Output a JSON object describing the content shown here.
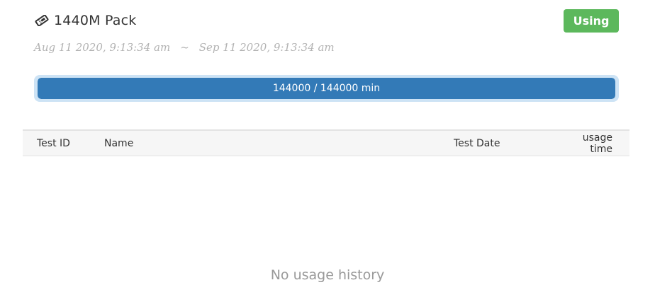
{
  "pack": {
    "icon": "ticket-icon",
    "title": "1440M Pack",
    "status": "Using",
    "status_color": "#5cb85c",
    "period_start": "Aug 11 2020, 9:13:34 am",
    "period_separator": "~",
    "period_end": "Sep 11 2020, 9:13:34 am"
  },
  "progress": {
    "used": 144000,
    "total": 144000,
    "fraction": 1.0,
    "label": "144000 / 144000 min",
    "bar_color": "#337ab7"
  },
  "table": {
    "columns": [
      "Test ID",
      "Name",
      "Test Date",
      "usage time"
    ],
    "rows": []
  },
  "empty_message": "No usage history"
}
